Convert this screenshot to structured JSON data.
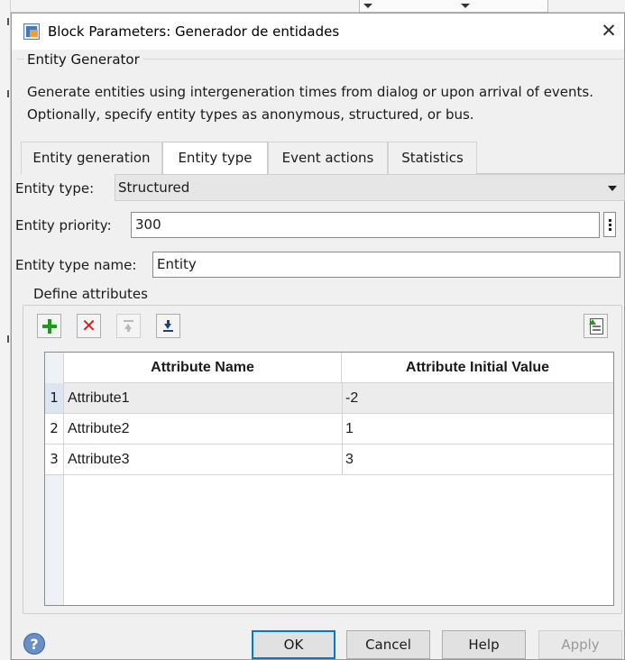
{
  "window": {
    "title": "Block Parameters: Generador de entidades",
    "close_glyph": "✕"
  },
  "block": {
    "group_label": "Entity Generator",
    "description": "Generate entities using intergeneration times from dialog or upon arrival of events. Optionally, specify entity types as anonymous, structured, or bus."
  },
  "tabs": [
    {
      "label": "Entity generation",
      "active": false
    },
    {
      "label": "Entity type",
      "active": true
    },
    {
      "label": "Event actions",
      "active": false
    },
    {
      "label": "Statistics",
      "active": false
    }
  ],
  "form": {
    "entity_type_label": "Entity type:",
    "entity_type_value": "Structured",
    "entity_priority_label": "Entity priority:",
    "entity_priority_value": "300",
    "entity_type_name_label": "Entity type name:",
    "entity_type_name_value": "Entity"
  },
  "attributes": {
    "group_label": "Define attributes",
    "toolbar": {
      "add_icon": "plus-icon",
      "delete_icon": "delete-x-icon",
      "move_up_icon": "move-up-icon",
      "move_down_icon": "move-down-icon",
      "import_icon": "import-icon",
      "delete_glyph": "✕"
    },
    "columns": [
      "Attribute Name",
      "Attribute Initial Value"
    ],
    "rows": [
      {
        "index": "1",
        "name": "Attribute1",
        "value": "-2",
        "selected": true
      },
      {
        "index": "2",
        "name": "Attribute2",
        "value": "1",
        "selected": false
      },
      {
        "index": "3",
        "name": "Attribute3",
        "value": "3",
        "selected": false
      }
    ]
  },
  "footer": {
    "help_icon_glyph": "?",
    "ok": "OK",
    "cancel": "Cancel",
    "help": "Help",
    "apply": "Apply"
  },
  "colors": {
    "accent": "#0078d7",
    "add_green": "#1f9a1f",
    "delete_red": "#e01818"
  }
}
